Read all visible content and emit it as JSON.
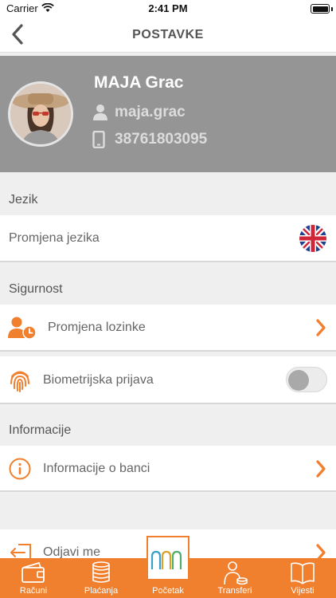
{
  "status": {
    "carrier": "Carrier",
    "time": "2:41 PM"
  },
  "nav": {
    "title": "POSTAVKE",
    "back_icon": "chevron-left-icon"
  },
  "profile": {
    "name": "MAJA Grac",
    "username": "maja.grac",
    "phone": "38761803095"
  },
  "sections": {
    "language": {
      "header": "Jezik",
      "item_label": "Promjena jezika",
      "flag": "uk-flag-icon"
    },
    "security": {
      "header": "Sigurnost",
      "password_label": "Promjena lozinke",
      "biometric_label": "Biometrijska prijava",
      "biometric_enabled": false
    },
    "info": {
      "header": "Informacije",
      "bank_info_label": "Informacije o banci"
    },
    "logout": {
      "label": "Odjavi me"
    }
  },
  "tabs": [
    {
      "label": "Računi",
      "icon": "wallet-icon"
    },
    {
      "label": "Plaćanja",
      "icon": "coins-icon"
    },
    {
      "label": "Početak",
      "icon": "bank-logo-icon"
    },
    {
      "label": "Transferi",
      "icon": "transfer-person-icon"
    },
    {
      "label": "Vijesti",
      "icon": "book-icon"
    }
  ],
  "colors": {
    "accent": "#f07f2e",
    "header_bg": "#959595",
    "page_bg": "#efefef"
  }
}
